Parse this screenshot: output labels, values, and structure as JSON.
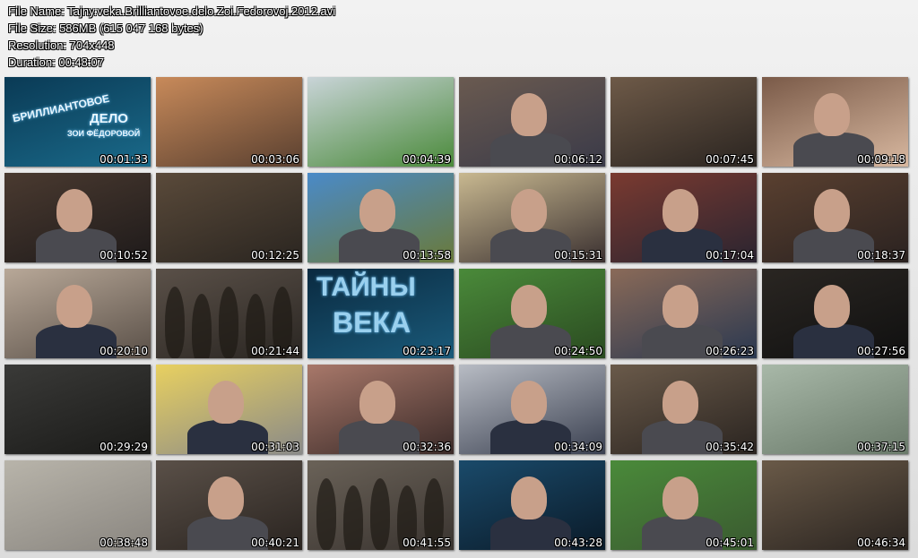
{
  "header": {
    "file_name": "File Name: Tajny.veka.Brilliantovoe.delo.Zoi.Fedorovoj.2012.avi",
    "file_size": "File Size: 586MB (615 047 168 bytes)",
    "resolution": "Resolution: 704x448",
    "duration": "Duration: 00:48:07"
  },
  "thumbs": [
    {
      "time": "00:01:33",
      "colors": [
        "#0a3a55",
        "#1a6a8a"
      ],
      "scene": "title"
    },
    {
      "time": "00:03:06",
      "colors": [
        "#c88a5a",
        "#5a4030"
      ],
      "scene": "city"
    },
    {
      "time": "00:04:39",
      "colors": [
        "#c9d4d8",
        "#4a8a3a"
      ],
      "scene": "street"
    },
    {
      "time": "00:06:12",
      "colors": [
        "#6a5a50",
        "#3a3a48"
      ],
      "scene": "man"
    },
    {
      "time": "00:07:45",
      "colors": [
        "#6e5a48",
        "#2a2420"
      ],
      "scene": "sepia"
    },
    {
      "time": "00:09:18",
      "colors": [
        "#7a5a48",
        "#d8b8a0"
      ],
      "scene": "woman"
    },
    {
      "time": "00:10:52",
      "colors": [
        "#4a3a30",
        "#1e1a1a"
      ],
      "scene": "man"
    },
    {
      "time": "00:12:25",
      "colors": [
        "#5a4a3a",
        "#2a2520"
      ],
      "scene": "sepia"
    },
    {
      "time": "00:13:58",
      "colors": [
        "#4a8ac8",
        "#6a7a3a"
      ],
      "scene": "woman"
    },
    {
      "time": "00:15:31",
      "colors": [
        "#c8b890",
        "#3a3030"
      ],
      "scene": "woman"
    },
    {
      "time": "00:17:04",
      "colors": [
        "#7a3a30",
        "#2a2430"
      ],
      "scene": "host"
    },
    {
      "time": "00:18:37",
      "colors": [
        "#5a4030",
        "#2a2220"
      ],
      "scene": "man"
    },
    {
      "time": "00:20:10",
      "colors": [
        "#b8a898",
        "#5a5048"
      ],
      "scene": "host"
    },
    {
      "time": "00:21:44",
      "colors": [
        "#5a5048",
        "#2a2622"
      ],
      "scene": "crowd"
    },
    {
      "time": "00:23:17",
      "colors": [
        "#0a2a40",
        "#1a5a7a"
      ],
      "scene": "logo"
    },
    {
      "time": "00:24:50",
      "colors": [
        "#4a8a3a",
        "#2a4a20"
      ],
      "scene": "man"
    },
    {
      "time": "00:26:23",
      "colors": [
        "#8a6a58",
        "#2a3850"
      ],
      "scene": "man"
    },
    {
      "time": "00:27:56",
      "colors": [
        "#2a2622",
        "#101010"
      ],
      "scene": "host"
    },
    {
      "time": "00:29:29",
      "colors": [
        "#3a3a38",
        "#1a1a18"
      ],
      "scene": "dark"
    },
    {
      "time": "00:31:03",
      "colors": [
        "#e8d060",
        "#8a8a88"
      ],
      "scene": "host"
    },
    {
      "time": "00:32:36",
      "colors": [
        "#a8786a",
        "#3a2a28"
      ],
      "scene": "woman"
    },
    {
      "time": "00:34:09",
      "colors": [
        "#b8bcc4",
        "#3a4050"
      ],
      "scene": "host"
    },
    {
      "time": "00:35:42",
      "colors": [
        "#6a5a4a",
        "#2a2420"
      ],
      "scene": "woman"
    },
    {
      "time": "00:37:15",
      "colors": [
        "#a8b8a8",
        "#6a7a6a"
      ],
      "scene": "sky"
    },
    {
      "time": "00:38:48",
      "colors": [
        "#b8b4aa",
        "#8a8680"
      ],
      "scene": "papers"
    },
    {
      "time": "00:40:21",
      "colors": [
        "#5a5048",
        "#2a2420"
      ],
      "scene": "woman"
    },
    {
      "time": "00:41:55",
      "colors": [
        "#6a6258",
        "#3a3430"
      ],
      "scene": "crowd"
    },
    {
      "time": "00:43:28",
      "colors": [
        "#1a4a6a",
        "#0a1a28"
      ],
      "scene": "host"
    },
    {
      "time": "00:45:01",
      "colors": [
        "#4a8a3a",
        "#3a5a30"
      ],
      "scene": "man"
    },
    {
      "time": "00:46:34",
      "colors": [
        "#6a5a48",
        "#2a2420"
      ],
      "scene": "sepia"
    }
  ],
  "title_card": {
    "line1": "БРИЛЛИАНТОВОЕ",
    "line2": "ДЕЛО",
    "line3": "ЗОИ ФЁДОРОВОЙ"
  },
  "logo_card": {
    "line1": "ТАЙНЫ",
    "line2": "ВЕКА"
  }
}
